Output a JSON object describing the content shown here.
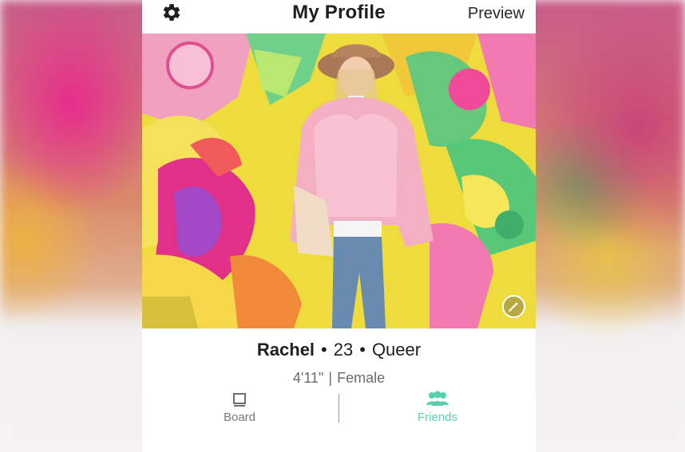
{
  "header": {
    "title": "My Profile",
    "preview_label": "Preview",
    "settings_icon": "gear-icon"
  },
  "photo": {
    "edit_icon": "pencil-icon",
    "description_colors": {
      "pink": "#f06aa8",
      "yellow": "#f2e24a",
      "green": "#57c07a",
      "purple": "#a04cc0"
    }
  },
  "profile": {
    "name": "Rachel",
    "age": "23",
    "orientation": "Queer",
    "height": "4'11\"",
    "gender": "Female",
    "bullet": "•",
    "pipe": "|"
  },
  "tabs": [
    {
      "label": "Board",
      "icon": "board-icon",
      "active": false
    },
    {
      "label": "Friends",
      "icon": "friends-icon",
      "active": true
    }
  ],
  "colors": {
    "accent": "#58d0b0",
    "text": "#1f1f1f",
    "muted": "#6b6b6b"
  }
}
